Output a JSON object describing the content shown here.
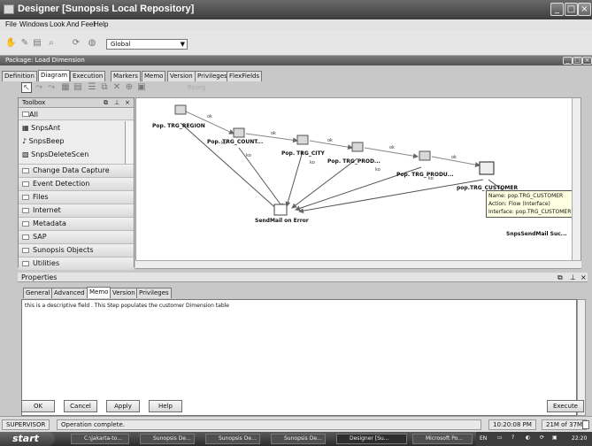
{
  "window": {
    "title": "Designer [Sunopsis Local Repository]"
  },
  "menu": {
    "items": [
      "File",
      "Windows",
      "Look And Feel",
      "Help"
    ]
  },
  "toolbar": {
    "context_value": "Global"
  },
  "package": {
    "title": "Package: Load Dimension"
  },
  "tabs": [
    "Definition",
    "Diagram",
    "Execution",
    "Markers",
    "Memo",
    "Version",
    "Privileges",
    "FlexFields"
  ],
  "active_tab": "Diagram",
  "diagram_toolbar": {
    "disabled_label": "Reorg"
  },
  "toolbox": {
    "title": "Toolbox",
    "all_label": "All",
    "tools": [
      "SnpsAnt",
      "SnpsBeep",
      "SnpsDeleteScen"
    ],
    "categories": [
      "Change Data Capture",
      "Event Detection",
      "Files",
      "Internet",
      "Metadata",
      "SAP",
      "Sunopsis Objects",
      "Utilities"
    ]
  },
  "diagram": {
    "steps": [
      "Pop. TRG_REGION",
      "Pop. TRG_COUNT...",
      "Pop. TRG_CITY",
      "Pop. TRG_PROD...",
      "Pop. TRG_PRODU...",
      "pop.TRG_CUSTOMER"
    ],
    "ok_label": "ok",
    "ko_label": "ko",
    "error_node": "SendMail on Error",
    "success_node": "SnpsSendMail Suc...",
    "tooltip": {
      "name": "Name: pop.TRG_CUSTOMER",
      "action": "Action: Flow (Interface)",
      "interface": "Interface: pop.TRG_CUSTOMER"
    }
  },
  "properties": {
    "title": "Properties",
    "tabs": [
      "General",
      "Advanced",
      "Memo",
      "Version",
      "Privileges"
    ],
    "active_tab": "Memo",
    "memo_text": "this is a descriptive field . This Step populates the customer Dimension table"
  },
  "buttons": {
    "ok": "OK",
    "cancel": "Cancel",
    "apply": "Apply",
    "help": "Help",
    "execute": "Execute"
  },
  "status": {
    "user": "SUPERVISOR",
    "message": "Operation complete.",
    "time": "10:20:08 PM",
    "memory": "21M of 37M"
  },
  "taskbar": {
    "start": "start",
    "tasks": [
      "C:\\jakarta-to...",
      "Sunopsis De...",
      "Sunopsis De...",
      "Sunopsis De...",
      "Designer [Su...",
      "Microsoft Po..."
    ],
    "active_task": "Designer [Su...",
    "lang": "EN",
    "clock": "22:20"
  },
  "colors": {
    "titlebar": "#4a4a4a",
    "canvas": "#ffffff",
    "tooltip_bg": "#ffffe1"
  }
}
